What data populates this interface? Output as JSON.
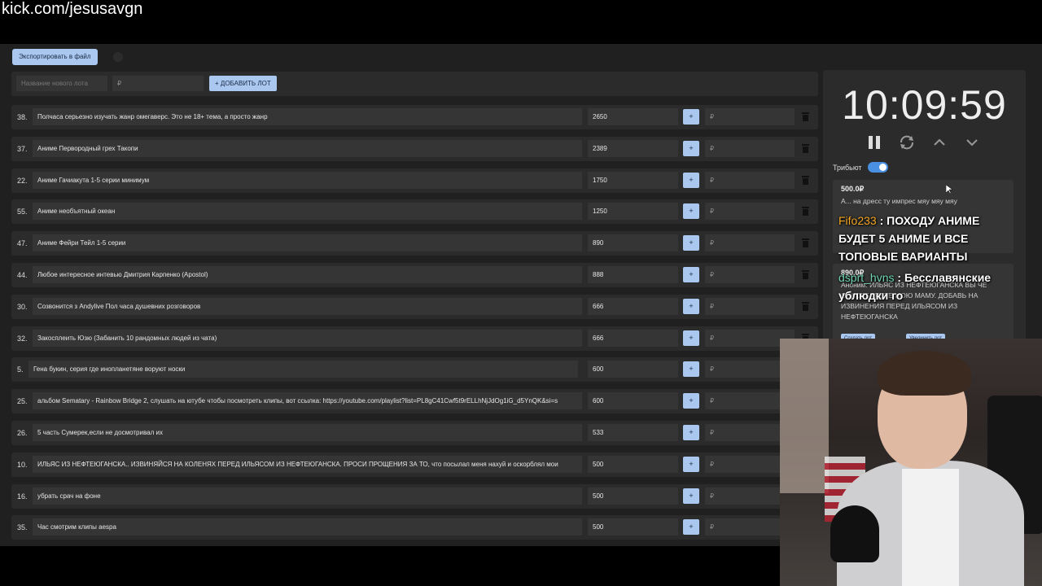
{
  "url_overlay": "kick.com/jesusavgn",
  "toolbar": {
    "export_label": "Экспортировать в файл"
  },
  "add_lot": {
    "name_placeholder": "Название нового лота",
    "price_placeholder": "₽",
    "add_label": "+ ДОБАВИТЬ ЛОТ"
  },
  "lot_ui": {
    "plus_label": "+",
    "currency": "₽"
  },
  "lots": [
    {
      "num": "38.",
      "name": "Полчаса серьезно изучать жанр омегаверс. Это не 18+ тема, а просто жанр",
      "amount": "2650"
    },
    {
      "num": "37.",
      "name": "Аниме Первородный грех Такопи",
      "amount": "2389"
    },
    {
      "num": "22.",
      "name": "Аниме Гачиакута 1-5 серии минимум",
      "amount": "1750"
    },
    {
      "num": "55.",
      "name": "Аниме необъятный океан",
      "amount": "1250"
    },
    {
      "num": "47.",
      "name": "Аниме Фейри Тейл 1-5 серии",
      "amount": "890"
    },
    {
      "num": "44.",
      "name": "Любое интересное интевью Дмитрия Карпенко (Apostol)",
      "amount": "888"
    },
    {
      "num": "30.",
      "name": "Созвонится з Andylive Пол часа душевних розговоров",
      "amount": "666"
    },
    {
      "num": "32.",
      "name": "Закосплеить Юзю (Забанить 10 рандомных людей из чата)",
      "amount": "666"
    },
    {
      "num": "5.",
      "name": "Гена букин, серия где инопланетяне воруют носки",
      "amount": "600"
    },
    {
      "num": "25.",
      "name": "альбом Sematary - Rainbow Bridge 2, слушать на ютубе чтобы посмотреть клипы, вот ссылка: https://youtube.com/playlist?list=PL8gC41Cwf5t9rELLhNjJdOg1iG_d5YnQK&si=s",
      "amount": "600"
    },
    {
      "num": "26.",
      "name": "5 часть Сумерек,если не досмотривал их",
      "amount": "533"
    },
    {
      "num": "10.",
      "name": "ИЛЬЯС ИЗ НЕФТЕЮГАНСКА.. ИЗВИНЯЙСЯ НА КОЛЕНЯХ ПЕРЕД ИЛЬЯСОМ ИЗ НЕФТЕЮГАНСКА. ПРОСИ ПРОЩЕНИЯ ЗА ТО, что посылал меня нахуй и оскорблял мои",
      "amount": "500"
    },
    {
      "num": "16.",
      "name": "убрать срач на фоне",
      "amount": "500"
    },
    {
      "num": "35.",
      "name": "Час смотрим клипы aespa",
      "amount": "500"
    }
  ],
  "timer": {
    "value": "10:09:59"
  },
  "tribute": {
    "label": "Трибьют",
    "enabled": true
  },
  "donations": [
    {
      "amount": "500.0₽",
      "text": "А... на дресс ту импрес мяу мяу мяу"
    },
    {
      "amount": "890.0₽",
      "text": "Аноним: ИЛЬЯС ИЗ НЕФТЕЮГАНСКА ВЫ ЧЕ ОСКОРБЛЯЕТЕ МОЮ МАМУ. ДОБАВЬ НА ИЗВИНЕНИЯ ПЕРЕД ИЛЬЯСОМ ИЗ НЕФТЕЮГАНСКА"
    }
  ],
  "donation_buttons": {
    "create": "Создать лот",
    "add": "Увеличить лот"
  },
  "chat": [
    {
      "user": "Fifo233",
      "sep": " : ",
      "text": "ПОХОДУ АНИМЕ БУДЕТ 5 АНИМЕ И ВСЕ ТОПОВЫЕ ВАРИАНТЫ"
    },
    {
      "user": "dsprt_hvns",
      "sep": " : ",
      "text": "Бесславянские ублюдки го"
    }
  ],
  "colors": {
    "accent": "#a9c7ef",
    "toggle": "#4a90e2",
    "panel": "#2b2b2b",
    "field": "#353535"
  }
}
